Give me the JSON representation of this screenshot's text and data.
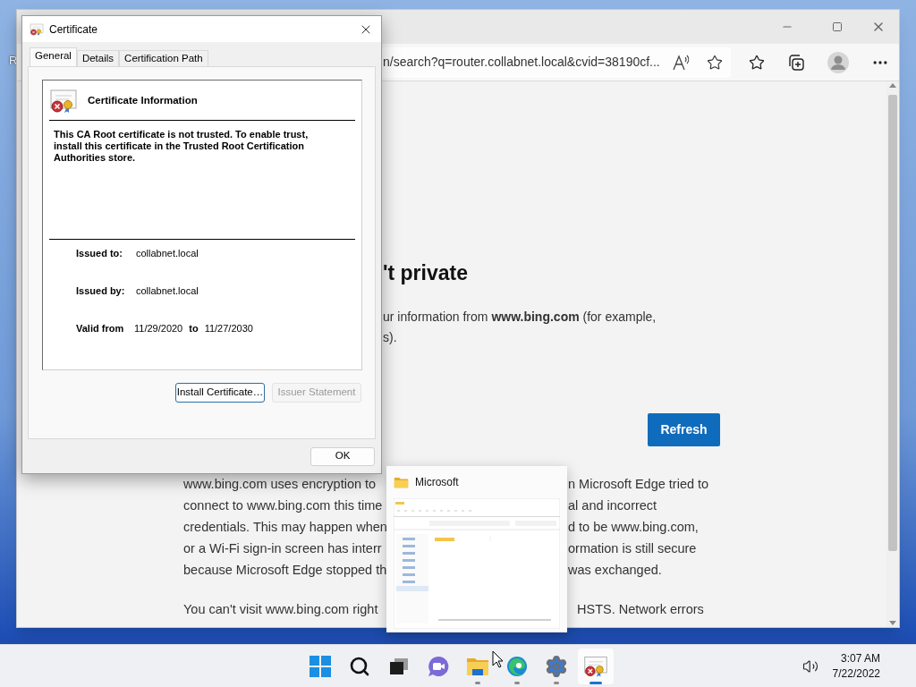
{
  "desktop": {
    "icon_label_fragment": "R"
  },
  "browser": {
    "address_fragment": "n/search?q=router.collabnet.local&cvid=38190cf...",
    "page": {
      "heading_fragment": "'t private",
      "intro_lines": [
        "ur information from **www.bing.com** (for example,",
        "s)."
      ],
      "refresh_button": "Refresh",
      "paragraph_lines": [
        {
          "left": "www.bing.com uses encryption to",
          "right": "n Microsoft Edge tried to"
        },
        {
          "left": "connect to www.bing.com this time",
          "right": "al and incorrect"
        },
        {
          "left": "credentials. This may happen when",
          "right": "d to be www.bing.com,"
        },
        {
          "left": "or a Wi-Fi sign-in screen has interr",
          "right": "ormation is still secure"
        },
        {
          "left": "because Microsoft Edge stopped th",
          "right": "was exchanged."
        }
      ],
      "last_line": {
        "left": "You can't visit www.bing.com right",
        "right": "HSTS. Network errors"
      }
    }
  },
  "certificate_dialog": {
    "title": "Certificate",
    "tabs": [
      {
        "label": "General",
        "selected": true
      },
      {
        "label": "Details",
        "selected": false
      },
      {
        "label": "Certification Path",
        "selected": false
      }
    ],
    "info_title": "Certificate Information",
    "message": "This CA Root certificate is not trusted. To enable trust, install this certificate in the Trusted Root Certification Authorities store.",
    "fields": [
      {
        "label": "Issued to:",
        "value": "collabnet.local"
      },
      {
        "label": "Issued by:",
        "value": "collabnet.local"
      }
    ],
    "validity": {
      "label": "Valid from",
      "from": "11/29/2020",
      "to_label": "to",
      "to": "11/27/2030"
    },
    "buttons": [
      {
        "label": "Install Certificate…",
        "disabled": false
      },
      {
        "label": "Issuer Statement",
        "disabled": true
      }
    ],
    "ok_button": "OK"
  },
  "thumbnail": {
    "title": "Microsoft"
  },
  "taskbar": {
    "apps": [
      {
        "kind": "start",
        "open": false,
        "selected": false
      },
      {
        "kind": "search",
        "open": false,
        "selected": false
      },
      {
        "kind": "task-view",
        "open": false,
        "selected": false
      },
      {
        "kind": "chat",
        "open": false,
        "selected": false
      },
      {
        "kind": "explorer",
        "open": true,
        "selected": false
      },
      {
        "kind": "edge",
        "open": true,
        "selected": false
      },
      {
        "kind": "settings",
        "open": true,
        "selected": false
      },
      {
        "kind": "certificate",
        "open": true,
        "selected": true
      }
    ],
    "clock": {
      "time": "3:07 AM",
      "date": "7/22/2022"
    }
  }
}
